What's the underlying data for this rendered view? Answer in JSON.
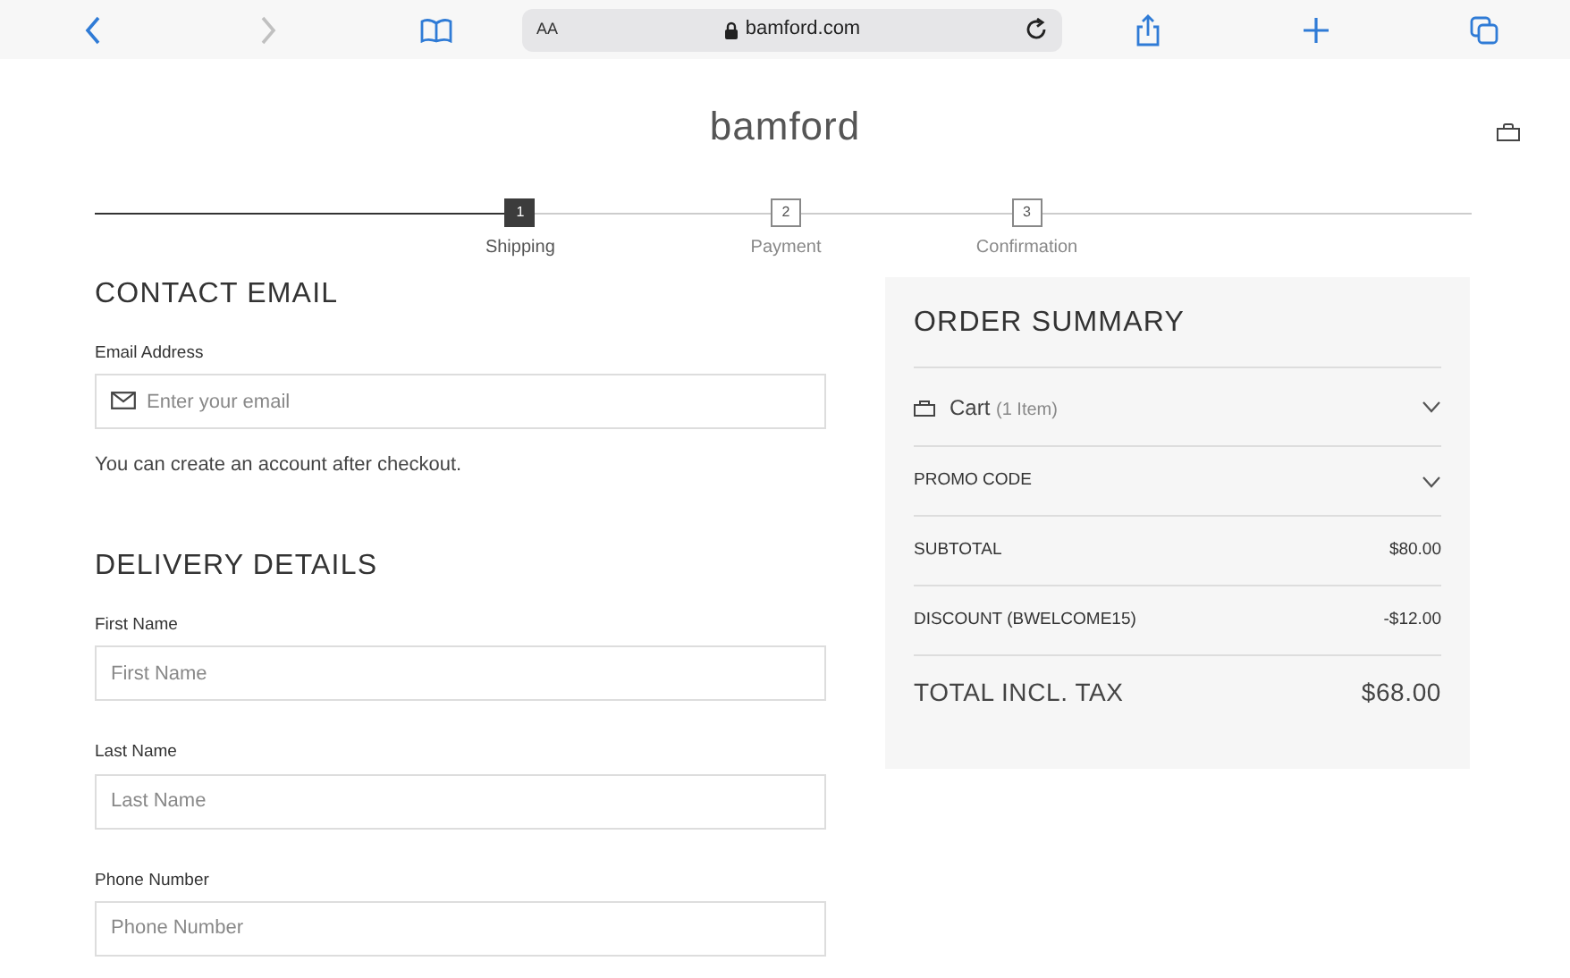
{
  "browser": {
    "back_disabled": false,
    "forward_disabled": true,
    "text_size": "AA",
    "url": "bamford.com"
  },
  "header": {
    "logo": "bamford"
  },
  "steps": [
    {
      "number": "1",
      "label": "Shipping",
      "selected": true
    },
    {
      "number": "2",
      "label": "Payment",
      "selected": false
    },
    {
      "number": "3",
      "label": "Confirmation",
      "selected": false
    }
  ],
  "contact": {
    "title": "CONTACT EMAIL",
    "email_label": "Email Address",
    "email_placeholder": "Enter your email",
    "note": "You can create an account after checkout."
  },
  "delivery": {
    "title": "DELIVERY DETAILS",
    "fields": [
      {
        "label": "First Name",
        "placeholder": "First Name"
      },
      {
        "label": "Last Name",
        "placeholder": "Last Name"
      },
      {
        "label": "Phone Number",
        "placeholder": "Phone Number"
      }
    ]
  },
  "summary": {
    "title": "ORDER SUMMARY",
    "cart_label": "Cart",
    "cart_count": "(1 Item)",
    "cart_expanded": false,
    "promo_label": "PROMO CODE",
    "promo_expanded": false,
    "lines": [
      {
        "label": "SUBTOTAL",
        "value": "$80.00"
      },
      {
        "label": "DISCOUNT (BWELCOME15)",
        "value": "-$12.00"
      }
    ],
    "total_label": "TOTAL INCL. TAX",
    "total_value": "$68.00"
  }
}
